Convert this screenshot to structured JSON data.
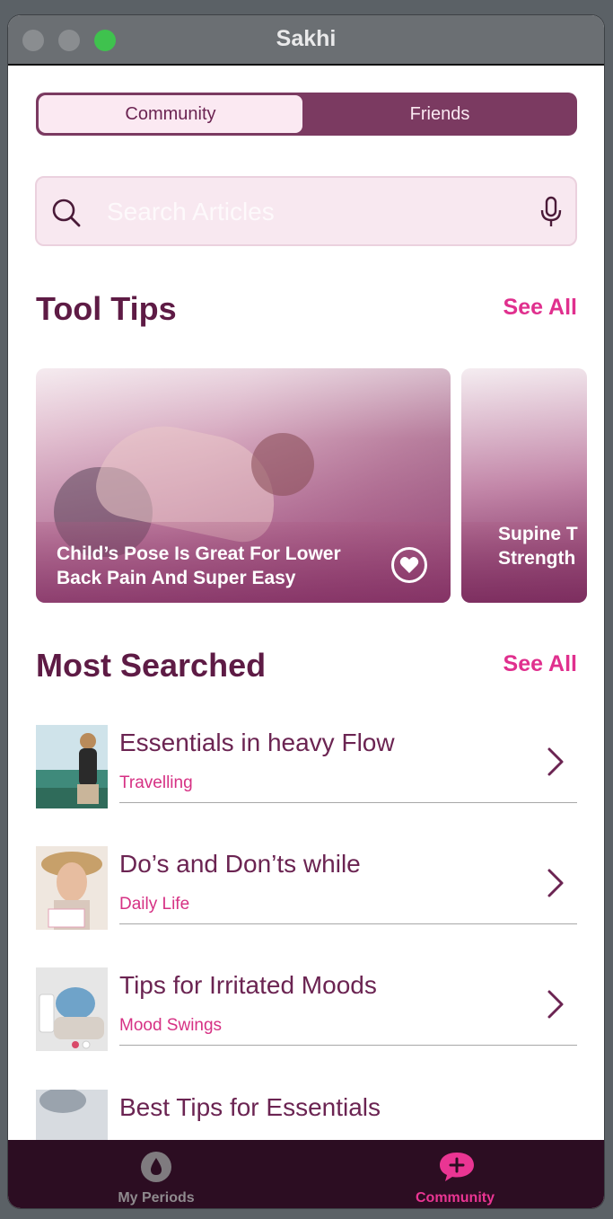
{
  "window": {
    "title": "Sakhi"
  },
  "segment": {
    "active_label": "Community",
    "inactive_label": "Friends"
  },
  "search": {
    "placeholder": "Search Articles",
    "value": ""
  },
  "tool_tips": {
    "title": "Tool Tips",
    "see_all": "See All",
    "cards": [
      {
        "line1": "Child’s Pose Is Great For Lower",
        "line2": "Back Pain And Super Easy"
      },
      {
        "line1": "Supine T",
        "line2": "Strength"
      }
    ]
  },
  "most_searched": {
    "title": "Most Searched",
    "see_all": "See All",
    "items": [
      {
        "title": "Essentials in heavy Flow",
        "category": "Travelling"
      },
      {
        "title": "Do’s and Don’ts while",
        "category": "Daily Life"
      },
      {
        "title": "Tips for Irritated Moods",
        "category": "Mood Swings"
      },
      {
        "title": "Best Tips for Essentials",
        "category": ""
      }
    ]
  },
  "tabbar": {
    "items": [
      {
        "label": "My Periods",
        "icon": "drop-icon"
      },
      {
        "label": "Community",
        "icon": "chat-plus-icon"
      }
    ]
  },
  "colors": {
    "accent": "#e0308e",
    "brand": "#7b3a61",
    "heading": "#5e1b45",
    "tabbar": "#2c0d22"
  }
}
